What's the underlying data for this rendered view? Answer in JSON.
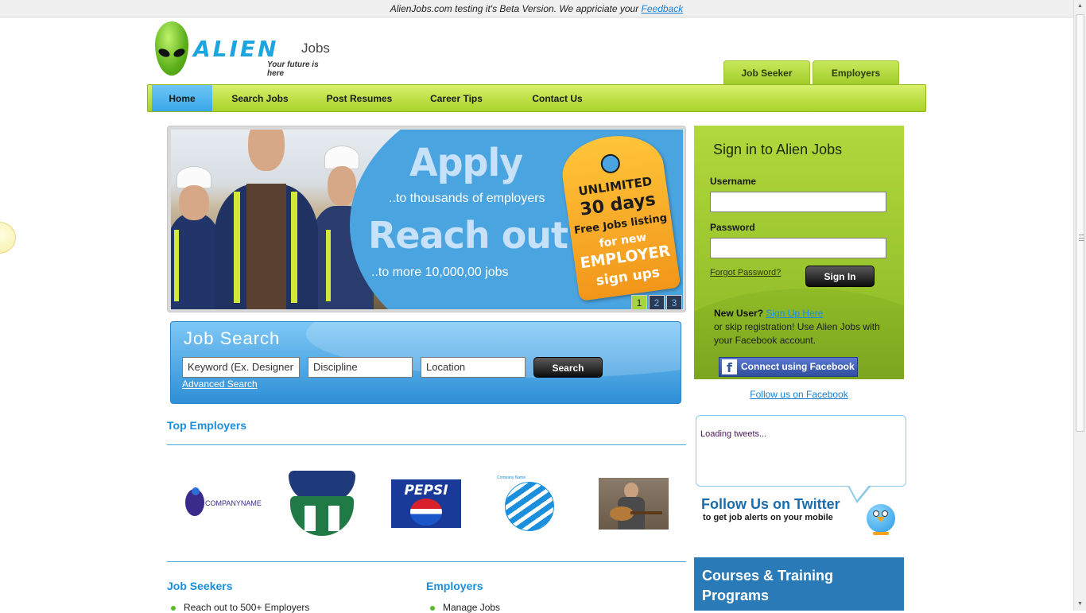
{
  "beta_bar": {
    "text": "AlienJobs.com testing it's Beta Version. We appriciate your ",
    "link": "Feedback"
  },
  "logo": {
    "brand": "ALIEN",
    "brand_suffix": "Jobs",
    "tagline": "Your future is here"
  },
  "top_tabs": [
    "Job Seeker",
    "Employers"
  ],
  "nav": {
    "items": [
      "Home",
      "Search Jobs",
      "Post Resumes",
      "Career Tips",
      "Contact Us"
    ],
    "active": "Home"
  },
  "banner": {
    "apply": "Apply",
    "apply_sub": "..to thousands of employers",
    "reach": "Reach out",
    "reach_sub": "..to more 10,000,00 jobs",
    "tag": {
      "line1": "UNLIMITED",
      "line2": "30 days",
      "line3": "Free Jobs listing",
      "line4": "for new",
      "line5": "EMPLOYER",
      "line6": "sign ups"
    },
    "pages": [
      "1",
      "2",
      "3"
    ],
    "active_page": "1"
  },
  "job_search": {
    "title": "Job Search",
    "keyword_value": "Keyword (Ex. Designer",
    "discipline_value": "Discipline",
    "location_value": "Location",
    "search_button": "Search",
    "advanced_link": "Advanced Search"
  },
  "top_employers": {
    "heading": "Top Employers",
    "logos": [
      {
        "name": "company-name-logo",
        "text": "COMPANYNAME"
      },
      {
        "name": "whalers-logo",
        "text": ""
      },
      {
        "name": "pepsi-logo",
        "text": "PEPSI"
      },
      {
        "name": "globe-logo",
        "text": "Company Name"
      },
      {
        "name": "guitarist-photo",
        "text": ""
      }
    ]
  },
  "job_seekers": {
    "heading": "Job Seekers",
    "items": [
      "Reach out to 500+ Employers"
    ]
  },
  "employers": {
    "heading": "Employers",
    "items": [
      "Manage Jobs"
    ]
  },
  "signin": {
    "title": "Sign in to Alien Jobs",
    "username_label": "Username",
    "password_label": "Password",
    "forgot": "Forgot Password?",
    "button": "Sign In",
    "new_user": "New User?",
    "signup_link": "Sign Up Here",
    "skip_text": "or skip registration! Use Alien Jobs with your Facebook account.",
    "fb_button": "Connect using Facebook"
  },
  "follow_facebook": "Follow us on Facebook",
  "twitter": {
    "loading": "Loading tweets...",
    "title": "Follow Us on Twitter",
    "subtitle": "to get job alerts on your mobile"
  },
  "courses": {
    "title": "Courses & Training Programs"
  },
  "colors": {
    "nav_green": "#b8dd3e",
    "accent_blue": "#1b8fdc",
    "signin_green": "#9dc52e",
    "courses_blue": "#2a7ab8"
  }
}
